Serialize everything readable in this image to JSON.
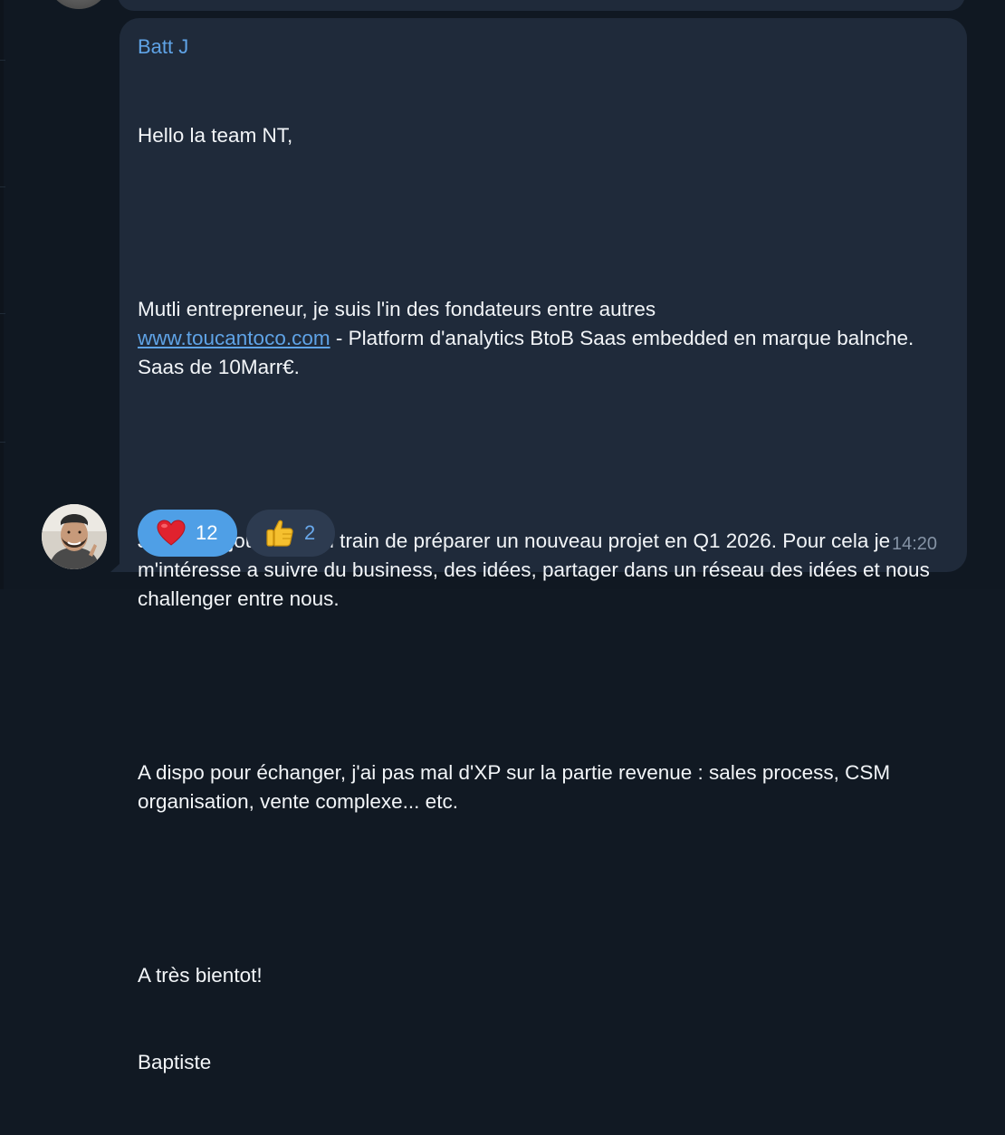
{
  "message": {
    "sender": "Batt J",
    "greeting": "Hello la team NT,",
    "para1_before_link": "Mutli entrepreneur, je suis l'in des fondateurs entre autres",
    "link": "www.toucantoco.com",
    "para1_after_link": " - Platform d'analytics BtoB Saas embedded en marque balnche. Saas de 10Marr€.",
    "para2": "Je suis aujourd'hui en train de préparer un nouveau projet en Q1 2026. Pour cela je m'intéresse a suivre du business, des idées, partager dans un réseau des idées et nous challenger entre nous.",
    "para3": "A dispo pour échanger, j'ai pas mal d'XP sur la partie revenue : sales process, CSM organisation, vente complexe... etc.",
    "closing": "A très bientot!",
    "signature": "Baptiste",
    "time": "14:20"
  },
  "reactions": [
    {
      "emoji": "heart-icon",
      "count": "12",
      "active": true
    },
    {
      "emoji": "thumbs-up-icon",
      "count": "2",
      "active": false
    }
  ],
  "colors": {
    "background": "#101822",
    "bubble": "#1f2a3a",
    "sender": "#5fa3e6",
    "link": "#5fa3e6",
    "active_reaction": "#4f9fe6",
    "inactive_reaction": "#2d3b50",
    "timestamp": "#8593a5"
  }
}
